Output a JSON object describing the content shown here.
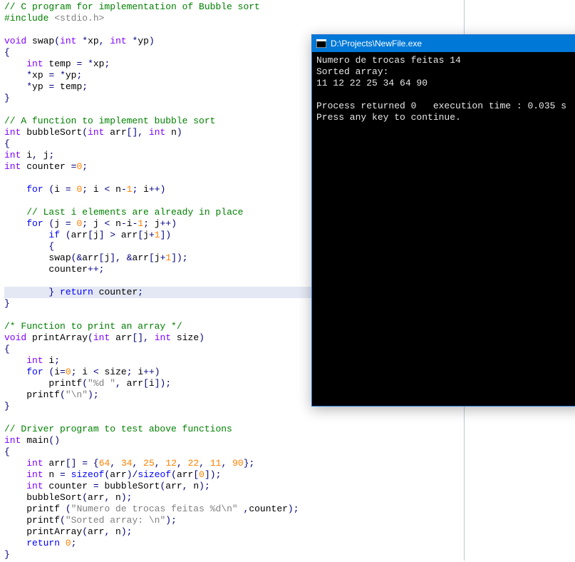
{
  "console": {
    "title": "D:\\Projects\\NewFile.exe",
    "lines": [
      "Numero de trocas feitas 14",
      "Sorted array:",
      "11 12 22 25 34 64 90",
      "",
      "Process returned 0   execution time : 0.035 s",
      "Press any key to continue."
    ]
  },
  "code": {
    "lines": [
      {
        "t": "comment",
        "s": "// C program for implementation of Bubble sort"
      },
      {
        "t": "include",
        "pre": "#include ",
        "inc": "<stdio.h>"
      },
      {
        "t": "blank"
      },
      {
        "t": "html",
        "h": "<span class='c-type'>void</span> swap<span class='c-paren'>(</span><span class='c-type'>int</span> <span class='c-op'>*</span>xp<span class='c-op'>,</span> <span class='c-type'>int</span> <span class='c-op'>*</span>yp<span class='c-paren'>)</span>"
      },
      {
        "t": "html",
        "h": "<span class='c-paren'>{</span>",
        "mark": true
      },
      {
        "t": "html",
        "h": "    <span class='c-type'>int</span> temp <span class='c-op'>=</span> <span class='c-op'>*</span>xp<span class='c-op'>;</span>"
      },
      {
        "t": "html",
        "h": "    <span class='c-op'>*</span>xp <span class='c-op'>=</span> <span class='c-op'>*</span>yp<span class='c-op'>;</span>"
      },
      {
        "t": "html",
        "h": "    <span class='c-op'>*</span>yp <span class='c-op'>=</span> temp<span class='c-op'>;</span>"
      },
      {
        "t": "html",
        "h": "<span class='c-paren'>}</span>"
      },
      {
        "t": "blank"
      },
      {
        "t": "comment",
        "s": "// A function to implement bubble sort"
      },
      {
        "t": "html",
        "h": "<span class='c-type'>int</span> bubbleSort<span class='c-paren'>(</span><span class='c-type'>int</span> arr<span class='c-paren'>[]</span><span class='c-op'>,</span> <span class='c-type'>int</span> n<span class='c-paren'>)</span>"
      },
      {
        "t": "html",
        "h": "<span class='c-paren'>{</span>",
        "mark": true
      },
      {
        "t": "html",
        "h": "<span class='c-type'>int</span> i<span class='c-op'>,</span> j<span class='c-op'>;</span>"
      },
      {
        "t": "html",
        "h": "<span class='c-type'>int</span> counter <span class='c-op'>=</span><span class='c-num'>0</span><span class='c-op'>;</span>"
      },
      {
        "t": "blank"
      },
      {
        "t": "html",
        "h": "    <span class='c-keyword'>for</span> <span class='c-paren'>(</span>i <span class='c-op'>=</span> <span class='c-num'>0</span><span class='c-op'>;</span> i <span class='c-op'>&lt;</span> n<span class='c-op'>-</span><span class='c-num'>1</span><span class='c-op'>;</span> i<span class='c-op'>++</span><span class='c-paren'>)</span>"
      },
      {
        "t": "blank"
      },
      {
        "t": "html",
        "h": "    <span class='c-comment'>// Last i elements are already in place</span>"
      },
      {
        "t": "html",
        "h": "    <span class='c-keyword'>for</span> <span class='c-paren'>(</span>j <span class='c-op'>=</span> <span class='c-num'>0</span><span class='c-op'>;</span> j <span class='c-op'>&lt;</span> n<span class='c-op'>-</span>i<span class='c-op'>-</span><span class='c-num'>1</span><span class='c-op'>;</span> j<span class='c-op'>++</span><span class='c-paren'>)</span>"
      },
      {
        "t": "html",
        "h": "        <span class='c-keyword'>if</span> <span class='c-paren'>(</span>arr<span class='c-paren'>[</span>j<span class='c-paren'>]</span> <span class='c-op'>&gt;</span> arr<span class='c-paren'>[</span>j<span class='c-op'>+</span><span class='c-num'>1</span><span class='c-paren'>])</span>"
      },
      {
        "t": "html",
        "h": "        <span class='c-paren'>{</span>"
      },
      {
        "t": "html",
        "h": "        swap<span class='c-paren'>(</span><span class='c-op'>&amp;</span>arr<span class='c-paren'>[</span>j<span class='c-paren'>]</span><span class='c-op'>,</span> <span class='c-op'>&amp;</span>arr<span class='c-paren'>[</span>j<span class='c-op'>+</span><span class='c-num'>1</span><span class='c-paren'>])</span><span class='c-op'>;</span>"
      },
      {
        "t": "html",
        "h": "        counter<span class='c-op'>++;</span>"
      },
      {
        "t": "blank"
      },
      {
        "t": "html",
        "h": "        <span class='c-paren'>}</span> <span class='c-keyword'>return</span> counter<span class='c-op'>;</span>",
        "hl": true
      },
      {
        "t": "html",
        "h": "<span class='c-paren'>}</span>"
      },
      {
        "t": "blank"
      },
      {
        "t": "comment",
        "s": "/* Function to print an array */"
      },
      {
        "t": "html",
        "h": "<span class='c-type'>void</span> printArray<span class='c-paren'>(</span><span class='c-type'>int</span> arr<span class='c-paren'>[]</span><span class='c-op'>,</span> <span class='c-type'>int</span> size<span class='c-paren'>)</span>"
      },
      {
        "t": "html",
        "h": "<span class='c-paren'>{</span>",
        "mark": true
      },
      {
        "t": "html",
        "h": "    <span class='c-type'>int</span> i<span class='c-op'>;</span>"
      },
      {
        "t": "html",
        "h": "    <span class='c-keyword'>for</span> <span class='c-paren'>(</span>i<span class='c-op'>=</span><span class='c-num'>0</span><span class='c-op'>;</span> i <span class='c-op'>&lt;</span> size<span class='c-op'>;</span> i<span class='c-op'>++</span><span class='c-paren'>)</span>"
      },
      {
        "t": "html",
        "h": "        printf<span class='c-paren'>(</span><span class='c-str'>\"%d \"</span><span class='c-op'>,</span> arr<span class='c-paren'>[</span>i<span class='c-paren'>])</span><span class='c-op'>;</span>"
      },
      {
        "t": "html",
        "h": "    printf<span class='c-paren'>(</span><span class='c-str'>\"\\n\"</span><span class='c-paren'>)</span><span class='c-op'>;</span>"
      },
      {
        "t": "html",
        "h": "<span class='c-paren'>}</span>"
      },
      {
        "t": "blank"
      },
      {
        "t": "comment",
        "s": "// Driver program to test above functions"
      },
      {
        "t": "html",
        "h": "<span class='c-type'>int</span> main<span class='c-paren'>()</span>"
      },
      {
        "t": "html",
        "h": "<span class='c-paren'>{</span>",
        "mark": true
      },
      {
        "t": "html",
        "h": "    <span class='c-type'>int</span> arr<span class='c-paren'>[]</span> <span class='c-op'>=</span> <span class='c-paren'>{</span><span class='c-num'>64</span><span class='c-op'>,</span> <span class='c-num'>34</span><span class='c-op'>,</span> <span class='c-num'>25</span><span class='c-op'>,</span> <span class='c-num'>12</span><span class='c-op'>,</span> <span class='c-num'>22</span><span class='c-op'>,</span> <span class='c-num'>11</span><span class='c-op'>,</span> <span class='c-num'>90</span><span class='c-paren'>}</span><span class='c-op'>;</span>"
      },
      {
        "t": "html",
        "h": "    <span class='c-type'>int</span> n <span class='c-op'>=</span> <span class='c-keyword'>sizeof</span><span class='c-paren'>(</span>arr<span class='c-paren'>)</span><span class='c-op'>/</span><span class='c-keyword'>sizeof</span><span class='c-paren'>(</span>arr<span class='c-paren'>[</span><span class='c-num'>0</span><span class='c-paren'>])</span><span class='c-op'>;</span>"
      },
      {
        "t": "html",
        "h": "    <span class='c-type'>int</span> counter <span class='c-op'>=</span> bubbleSort<span class='c-paren'>(</span>arr<span class='c-op'>,</span> n<span class='c-paren'>)</span><span class='c-op'>;</span>"
      },
      {
        "t": "html",
        "h": "    bubbleSort<span class='c-paren'>(</span>arr<span class='c-op'>,</span> n<span class='c-paren'>)</span><span class='c-op'>;</span>"
      },
      {
        "t": "html",
        "h": "    printf <span class='c-paren'>(</span><span class='c-str'>\"Numero de trocas feitas %d\\n\"</span> <span class='c-op'>,</span>counter<span class='c-paren'>)</span><span class='c-op'>;</span>"
      },
      {
        "t": "html",
        "h": "    printf<span class='c-paren'>(</span><span class='c-str'>\"Sorted array: \\n\"</span><span class='c-paren'>)</span><span class='c-op'>;</span>"
      },
      {
        "t": "html",
        "h": "    printArray<span class='c-paren'>(</span>arr<span class='c-op'>,</span> n<span class='c-paren'>)</span><span class='c-op'>;</span>"
      },
      {
        "t": "html",
        "h": "    <span class='c-keyword'>return</span> <span class='c-num'>0</span><span class='c-op'>;</span>"
      },
      {
        "t": "html",
        "h": "<span class='c-paren'>}</span>"
      }
    ]
  }
}
